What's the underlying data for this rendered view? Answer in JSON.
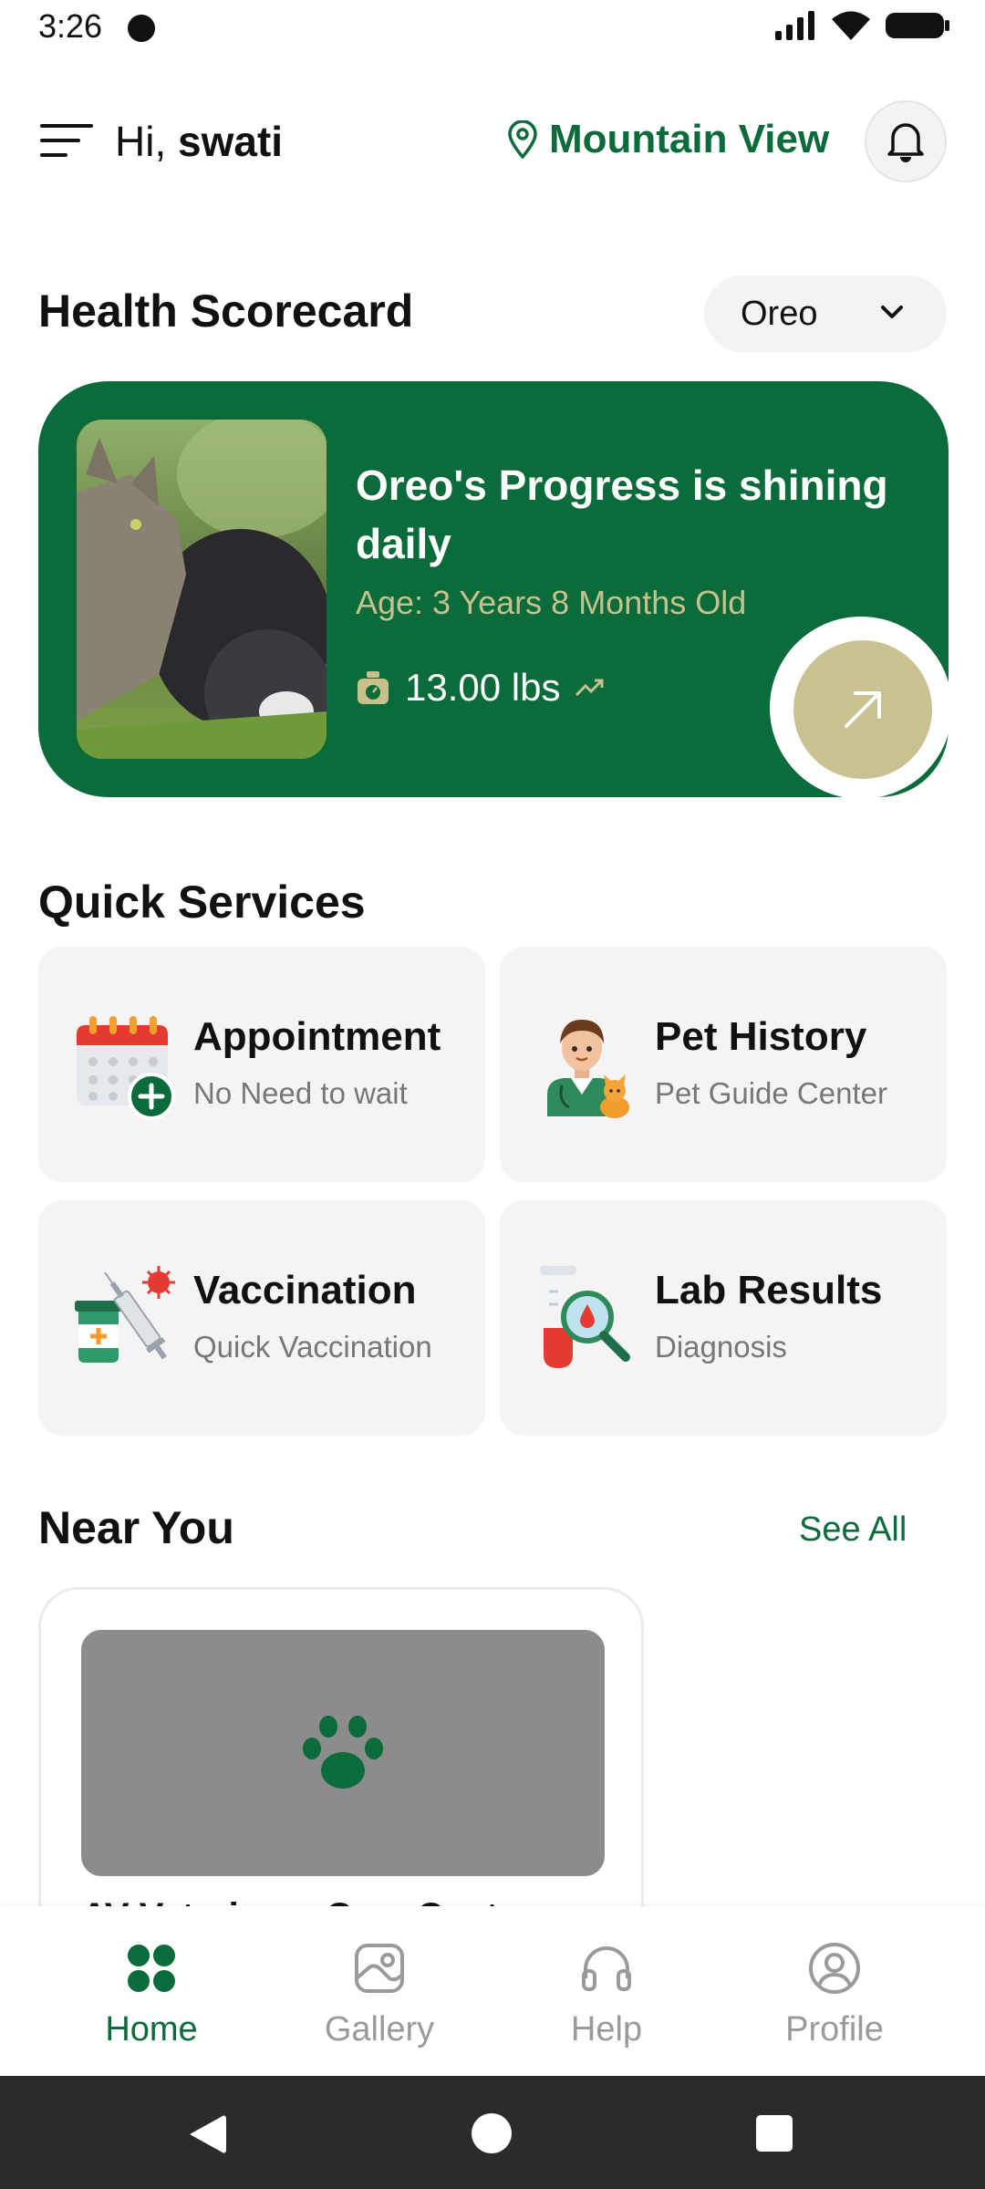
{
  "status_bar": {
    "time": "3:26"
  },
  "header": {
    "greeting_prefix": "Hi,",
    "user_name": "swati",
    "location": "Mountain View"
  },
  "health": {
    "section_title": "Health Scorecard",
    "pet_selector": "Oreo",
    "card_title": "Oreo's Progress is shining daily",
    "age": "Age: 3 Years 8 Months Old",
    "weight": "13.00 lbs"
  },
  "quick_services": {
    "section_title": "Quick Services",
    "items": [
      {
        "title": "Appointment",
        "subtitle": "No Need to wait",
        "icon": "calendar-add-icon"
      },
      {
        "title": "Pet History",
        "subtitle": "Pet Guide Center",
        "icon": "vet-with-cat-icon"
      },
      {
        "title": "Vaccination",
        "subtitle": "Quick Vaccination",
        "icon": "vaccine-syringe-icon"
      },
      {
        "title": "Lab Results",
        "subtitle": "Diagnosis",
        "icon": "lab-test-icon"
      }
    ]
  },
  "near_you": {
    "section_title": "Near You",
    "see_all": "See All",
    "places": [
      {
        "name": "AV Veterinary Care Center",
        "image_icon": "paw-icon"
      }
    ]
  },
  "bottom_nav": {
    "items": [
      {
        "label": "Home",
        "icon": "home-grid-icon",
        "active": true
      },
      {
        "label": "Gallery",
        "icon": "gallery-icon",
        "active": false
      },
      {
        "label": "Help",
        "icon": "headphones-icon",
        "active": false
      },
      {
        "label": "Profile",
        "icon": "profile-icon",
        "active": false
      }
    ]
  },
  "colors": {
    "brand_green": "#0b6b3a",
    "accent_khaki": "#c9c192",
    "card_muted_text": "#c7c18c"
  }
}
